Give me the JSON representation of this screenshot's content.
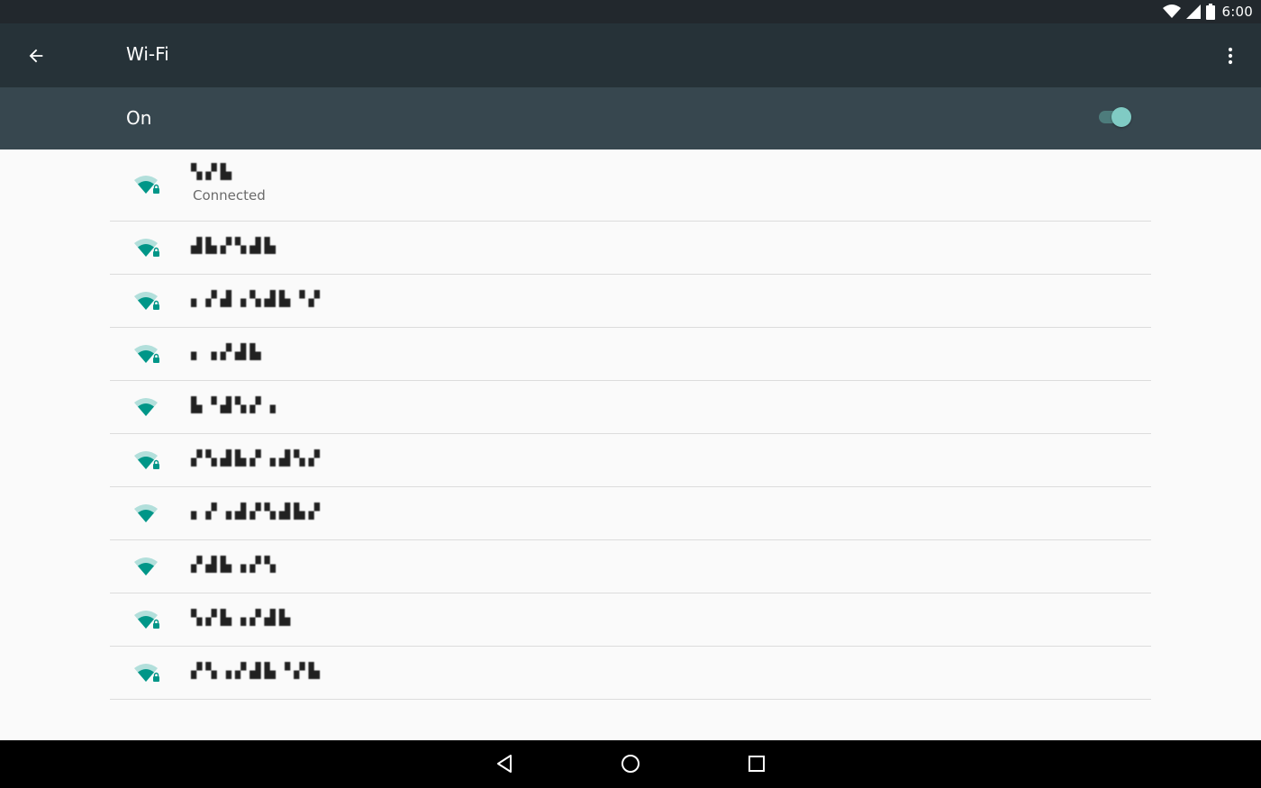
{
  "status_bar": {
    "time": "6:00",
    "icons": [
      "wifi-signal-icon",
      "cell-signal-icon",
      "battery-icon"
    ]
  },
  "app_bar": {
    "title": "Wi-Fi",
    "back_icon": "arrow-back-icon",
    "menu_icon": "more-vert-icon"
  },
  "master_switch": {
    "label": "On",
    "checked": true
  },
  "networks": [
    {
      "name": "▚▞▙",
      "summary": "Connected",
      "secured": true
    },
    {
      "name": "▟▙▞▚▟▙",
      "secured": true
    },
    {
      "name": "▖▞▟▗▚▟▙▝▞",
      "secured": true
    },
    {
      "name": "▖▗▞▟▙",
      "secured": true
    },
    {
      "name": "▙▝▟▚▞▗",
      "secured": false
    },
    {
      "name": "▞▚▟▙▞▗▟▚▞",
      "secured": true
    },
    {
      "name": "▖▞▗▟▞▚▟▙▞",
      "secured": false
    },
    {
      "name": "▞▟▙▗▞▚",
      "secured": false
    },
    {
      "name": "▚▞▙▗▞▟▙",
      "secured": true
    },
    {
      "name": "▞▚▗▞▟▙▝▞▙",
      "secured": true
    }
  ],
  "colors": {
    "status_bar": "#22282d",
    "app_bar": "#263238",
    "switch_bar": "#37474f",
    "accent": "#009688",
    "background": "#fafafa"
  },
  "nav_bar": {
    "icons": [
      "back-triangle-icon",
      "home-circle-icon",
      "recents-square-icon"
    ]
  }
}
